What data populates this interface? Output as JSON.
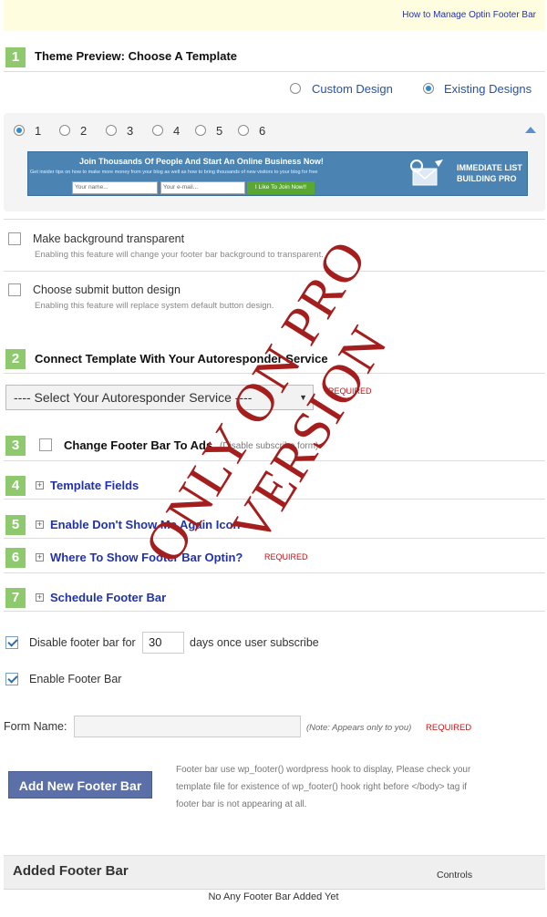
{
  "top_link": "How to Manage Optin Footer Bar",
  "section1": {
    "number": "1",
    "title": "Theme Preview: Choose A Template",
    "design_options": [
      "Custom Design",
      "Existing Designs"
    ],
    "selected_design": "Existing Designs",
    "templates": [
      "1",
      "2",
      "3",
      "4",
      "5",
      "6"
    ],
    "selected_template": "1",
    "banner": {
      "headline": "Join Thousands Of People And Start An Online Business Now!",
      "subline": "Get insider tips on how to make more money from your blog as well as how to bring thousands of new visitors to your blog for free",
      "name_placeholder": "Your name...",
      "email_placeholder": "Your e-mail...",
      "button": "I Like To Join Now!!",
      "logo_text": "IMMEDIATE LIST BUILDING PRO"
    },
    "options": [
      {
        "title": "Make background transparent",
        "desc": "Enabling this feature will change your footer bar background to transparent.",
        "checked": false
      },
      {
        "title": "Choose submit button design",
        "desc": "Enabling this feature will replace system default button design.",
        "checked": false
      }
    ]
  },
  "section2": {
    "number": "2",
    "title": "Connect Template With Your Autoresponder Service",
    "select_value": "---- Select Your Autoresponder Service ----",
    "required": "REQUIRED"
  },
  "section3": {
    "number": "3",
    "title": "Change Footer Bar To Ads",
    "note": "(Disable subscribe form)"
  },
  "section4": {
    "number": "4",
    "title": "Template Fields"
  },
  "section5": {
    "number": "5",
    "title": "Enable Don't Show Me Again Icon"
  },
  "section6": {
    "number": "6",
    "title": "Where To Show Footer Bar Optin?",
    "required": "REQUIRED"
  },
  "section7": {
    "number": "7",
    "title": "Schedule Footer Bar"
  },
  "disable_row": {
    "label_before": "Disable footer bar for",
    "days": "30",
    "label_after": "days once user subscribe",
    "checked": true
  },
  "enable_row": {
    "label": "Enable Footer Bar",
    "checked": true
  },
  "form_name": {
    "label": "Form Name:",
    "value": "",
    "note": "(Note: Appears only to you)",
    "required": "REQUIRED"
  },
  "add_button": "Add New Footer Bar",
  "hook_note": "Footer bar use wp_footer() wordpress hook to display, Please check your template file for existence of wp_footer() hook right before </body> tag if footer bar is not appearing at all.",
  "table": {
    "title": "Added Footer Bar",
    "controls": "Controls",
    "empty": "No Any Footer Bar Added Yet"
  },
  "watermark": "ONLY ON PRO VERSION",
  "colors": {
    "accent_green": "#8fc96e",
    "link_blue": "#2233aa",
    "required_red": "#d01010",
    "watermark_red": "#a41e1e"
  }
}
